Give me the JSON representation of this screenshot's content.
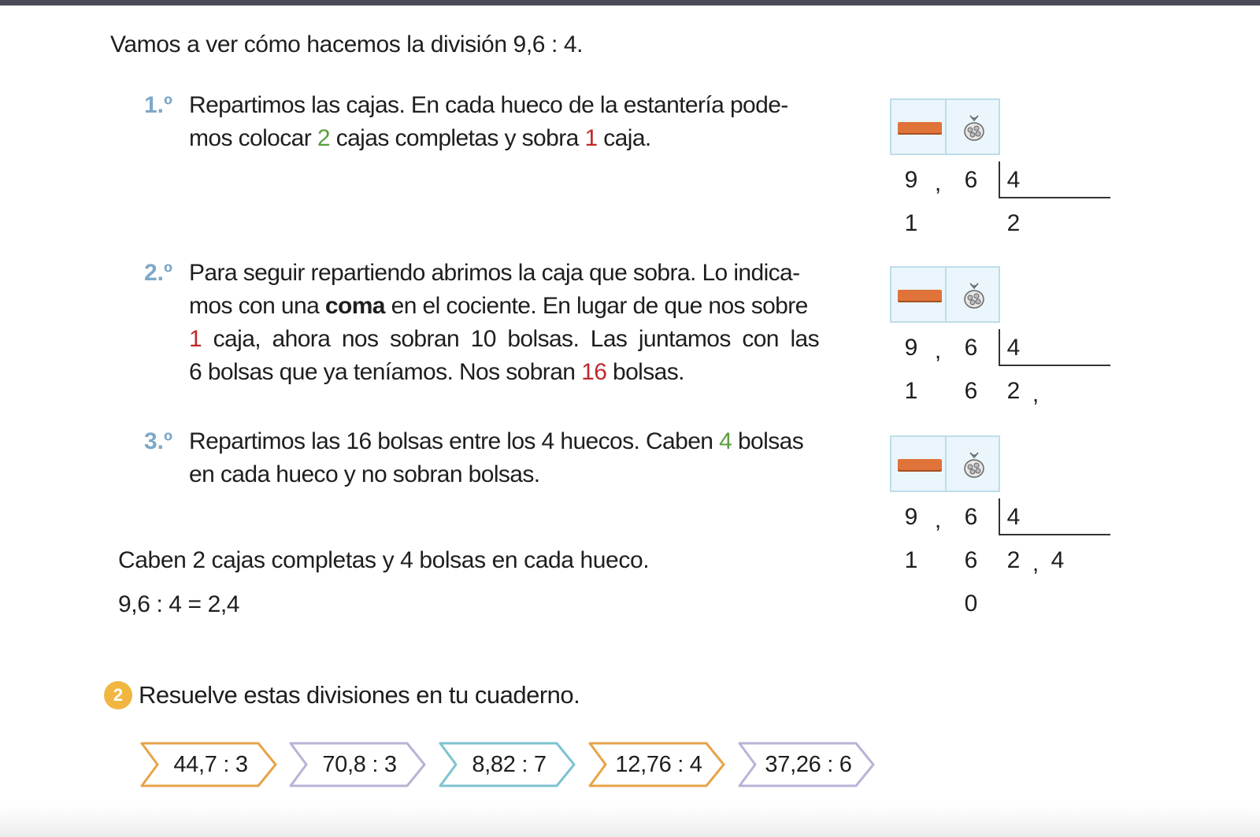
{
  "intro": "Vamos a ver cómo hacemos la división 9,6 : 4.",
  "colors": {
    "step_number": "#7ea8c8",
    "green": "#5a9e3f",
    "red": "#c0282b",
    "badge": "#f0b640",
    "shelf": "#eaf6fb",
    "box": "#e0733a"
  },
  "steps": [
    {
      "number": "1.º",
      "line1": "Repartimos las cajas. En cada hueco de la estantería pode-",
      "line2_a": "mos colocar ",
      "line2_g": "2",
      "line2_b": " cajas completas y sobra ",
      "line2_r": "1",
      "line2_c": " caja."
    },
    {
      "number": "2.º",
      "line1": "Para seguir repartiendo abrimos la caja que sobra. Lo indica-",
      "line2_a": "mos con una ",
      "line2_bold": "coma",
      "line2_b": " en el cociente. En lugar de que nos sobre",
      "line3_r": "1",
      "line3_a": " caja, ahora nos sobran 10 bolsas. Las juntamos con las",
      "line4_a": "6 bolsas que ya teníamos. Nos sobran ",
      "line4_r": "16",
      "line4_b": " bolsas."
    },
    {
      "number": "3.º",
      "line1_a": "Repartimos las 16 bolsas entre los 4 huecos. Caben ",
      "line1_g": "4",
      "line1_b": " bolsas",
      "line2": "en cada hueco y no sobran bolsas."
    }
  ],
  "divisions": [
    {
      "dividend": [
        "9",
        ",",
        "6"
      ],
      "divisor": "4",
      "rem1": "1",
      "rem2": "",
      "quot1": "2",
      "quot_comma": "",
      "quot2": "",
      "final_rem": ""
    },
    {
      "dividend": [
        "9",
        ",",
        "6"
      ],
      "divisor": "4",
      "rem1": "1",
      "rem2": "6",
      "quot1": "2",
      "quot_comma": ",",
      "quot2": "",
      "final_rem": ""
    },
    {
      "dividend": [
        "9",
        ",",
        "6"
      ],
      "divisor": "4",
      "rem1": "1",
      "rem2": "6",
      "quot1": "2",
      "quot_comma": ",",
      "quot2": "4",
      "final_rem": "0"
    }
  ],
  "summary": "Caben 2 cajas completas y 4 bolsas en cada hueco.",
  "equation": "9,6 : 4 = 2,4",
  "exercise": {
    "number": "2",
    "title": "Resuelve estas divisiones en tu cuaderno.",
    "items": [
      {
        "label": "44,7 : 3",
        "color": "#e8a34a"
      },
      {
        "label": "70,8 : 3",
        "color": "#b9b3d8"
      },
      {
        "label": "8,82 : 7",
        "color": "#7cc3cf"
      },
      {
        "label": "12,76 : 4",
        "color": "#e8a34a"
      },
      {
        "label": "37,26 : 6",
        "color": "#b9b3d8"
      }
    ]
  }
}
